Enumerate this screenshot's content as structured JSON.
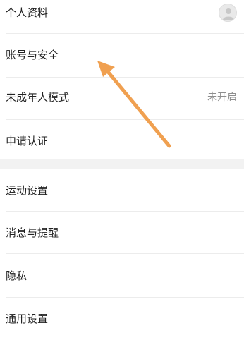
{
  "group1": [
    {
      "label": "个人资料",
      "trailing": "avatar"
    },
    {
      "label": "账号与安全"
    },
    {
      "label": "未成年人模式",
      "value": "未开启"
    },
    {
      "label": "申请认证"
    }
  ],
  "group2": [
    {
      "label": "运动设置"
    },
    {
      "label": "消息与提醒"
    },
    {
      "label": "隐私"
    },
    {
      "label": "通用设置"
    }
  ],
  "annotation": {
    "arrow_color": "#f0a050"
  },
  "colors": {
    "background": "#ffffff",
    "section_gap": "#f2f2f2",
    "divider": "#ececec",
    "text": "#222222",
    "muted": "#8e8e8e"
  }
}
